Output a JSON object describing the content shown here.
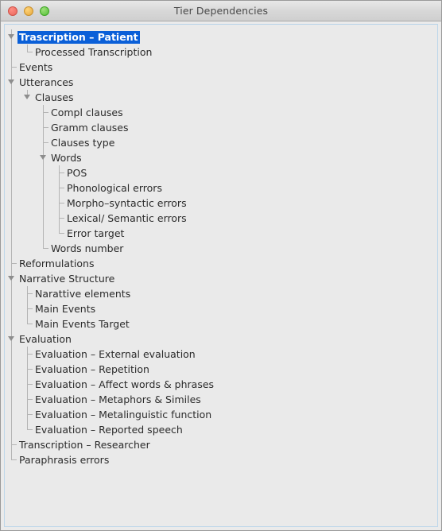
{
  "window": {
    "title": "Tier Dependencies",
    "controls": [
      {
        "name": "close-button",
        "label": "Close"
      },
      {
        "name": "minimize-button",
        "label": "Minimize"
      },
      {
        "name": "zoom-button",
        "label": "Zoom"
      }
    ]
  },
  "colors": {
    "selection": "#0a5fd8",
    "selection_text": "#ffffff",
    "tree_background": "#eaeaea",
    "titlebar_text": "#4a4a4a",
    "line": "#b4b4b4",
    "triangle": "#8d8d8d",
    "focus_border": "#bed7ea"
  },
  "tree": {
    "nodes": [
      {
        "label": "Trascription – Patient",
        "depth": 0,
        "expandable": true,
        "expanded": true,
        "selected": true,
        "last_child": false
      },
      {
        "label": "Processed Transcription",
        "depth": 1,
        "expandable": false,
        "expanded": false,
        "selected": false,
        "last_child": true
      },
      {
        "label": "Events",
        "depth": 0,
        "expandable": false,
        "expanded": false,
        "selected": false,
        "last_child": false
      },
      {
        "label": "Utterances",
        "depth": 0,
        "expandable": true,
        "expanded": true,
        "selected": false,
        "last_child": false
      },
      {
        "label": "Clauses",
        "depth": 1,
        "expandable": true,
        "expanded": true,
        "selected": false,
        "last_child": true
      },
      {
        "label": "Compl clauses",
        "depth": 2,
        "expandable": false,
        "expanded": false,
        "selected": false,
        "last_child": false
      },
      {
        "label": "Gramm clauses",
        "depth": 2,
        "expandable": false,
        "expanded": false,
        "selected": false,
        "last_child": false
      },
      {
        "label": "Clauses type",
        "depth": 2,
        "expandable": false,
        "expanded": false,
        "selected": false,
        "last_child": false
      },
      {
        "label": "Words",
        "depth": 2,
        "expandable": true,
        "expanded": true,
        "selected": false,
        "last_child": false
      },
      {
        "label": "POS",
        "depth": 3,
        "expandable": false,
        "expanded": false,
        "selected": false,
        "last_child": false
      },
      {
        "label": "Phonological errors",
        "depth": 3,
        "expandable": false,
        "expanded": false,
        "selected": false,
        "last_child": false
      },
      {
        "label": "Morpho–syntactic errors",
        "depth": 3,
        "expandable": false,
        "expanded": false,
        "selected": false,
        "last_child": false
      },
      {
        "label": "Lexical/ Semantic errors",
        "depth": 3,
        "expandable": false,
        "expanded": false,
        "selected": false,
        "last_child": false
      },
      {
        "label": "Error target",
        "depth": 3,
        "expandable": false,
        "expanded": false,
        "selected": false,
        "last_child": true
      },
      {
        "label": "Words number",
        "depth": 2,
        "expandable": false,
        "expanded": false,
        "selected": false,
        "last_child": true
      },
      {
        "label": "Reformulations",
        "depth": 0,
        "expandable": false,
        "expanded": false,
        "selected": false,
        "last_child": false
      },
      {
        "label": "Narrative Structure",
        "depth": 0,
        "expandable": true,
        "expanded": true,
        "selected": false,
        "last_child": false
      },
      {
        "label": "Narattive elements",
        "depth": 1,
        "expandable": false,
        "expanded": false,
        "selected": false,
        "last_child": false
      },
      {
        "label": "Main Events",
        "depth": 1,
        "expandable": false,
        "expanded": false,
        "selected": false,
        "last_child": false
      },
      {
        "label": "Main Events Target",
        "depth": 1,
        "expandable": false,
        "expanded": false,
        "selected": false,
        "last_child": true
      },
      {
        "label": "Evaluation",
        "depth": 0,
        "expandable": true,
        "expanded": true,
        "selected": false,
        "last_child": false
      },
      {
        "label": "Evaluation – External evaluation",
        "depth": 1,
        "expandable": false,
        "expanded": false,
        "selected": false,
        "last_child": false
      },
      {
        "label": "Evaluation – Repetition",
        "depth": 1,
        "expandable": false,
        "expanded": false,
        "selected": false,
        "last_child": false
      },
      {
        "label": "Evaluation – Affect words & phrases",
        "depth": 1,
        "expandable": false,
        "expanded": false,
        "selected": false,
        "last_child": false
      },
      {
        "label": "Evaluation – Metaphors & Similes",
        "depth": 1,
        "expandable": false,
        "expanded": false,
        "selected": false,
        "last_child": false
      },
      {
        "label": "Evaluation – Metalinguistic function",
        "depth": 1,
        "expandable": false,
        "expanded": false,
        "selected": false,
        "last_child": false
      },
      {
        "label": "Evaluation – Reported speech",
        "depth": 1,
        "expandable": false,
        "expanded": false,
        "selected": false,
        "last_child": true
      },
      {
        "label": "Transcription – Researcher",
        "depth": 0,
        "expandable": false,
        "expanded": false,
        "selected": false,
        "last_child": false
      },
      {
        "label": "Paraphrasis errors",
        "depth": 0,
        "expandable": false,
        "expanded": false,
        "selected": false,
        "last_child": true
      }
    ]
  }
}
